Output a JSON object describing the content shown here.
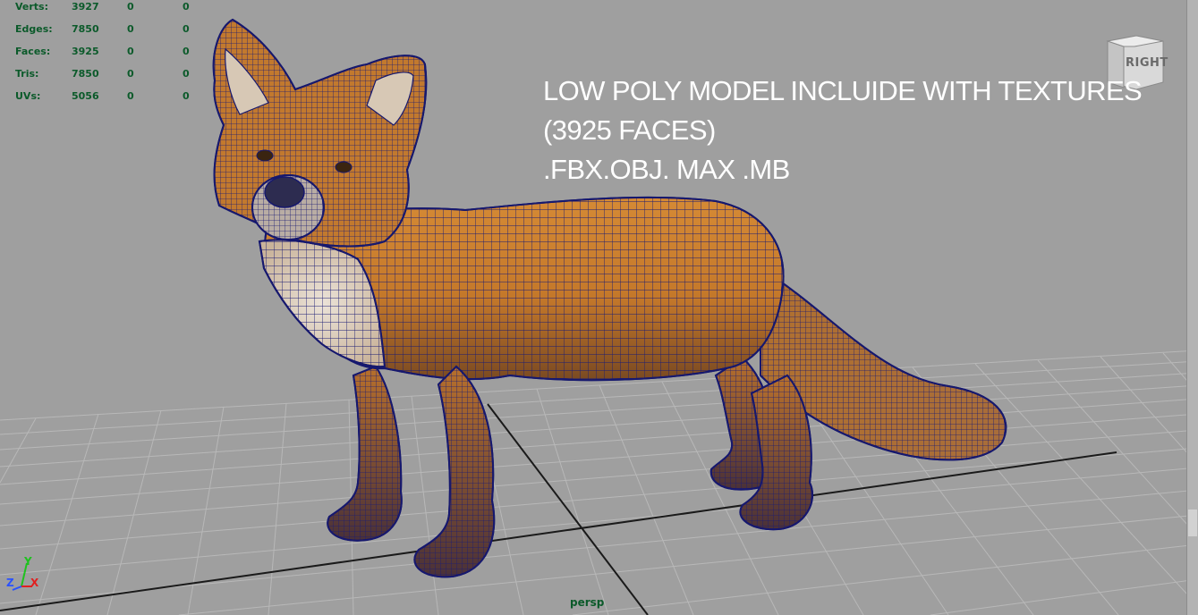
{
  "hud": {
    "rows": [
      {
        "label": "Verts:",
        "v1": "3927",
        "v2": "0",
        "v3": "0"
      },
      {
        "label": "Edges:",
        "v1": "7850",
        "v2": "0",
        "v3": "0"
      },
      {
        "label": "Faces:",
        "v1": "3925",
        "v2": "0",
        "v3": "0"
      },
      {
        "label": "Tris:",
        "v1": "7850",
        "v2": "0",
        "v3": "0"
      },
      {
        "label": "UVs:",
        "v1": "5056",
        "v2": "0",
        "v3": "0"
      }
    ]
  },
  "overlay": {
    "line1": "LOW POLY MODEL INCLUIDE WITH TEXTURES",
    "line2": "(3925 FACES)",
    "line3": ".FBX.OBJ. MAX .MB"
  },
  "viewcube": {
    "label": "RIGHT"
  },
  "camera": {
    "label": "persp"
  },
  "axis": {
    "x": "X",
    "y": "Y",
    "z": "Z"
  },
  "colors": {
    "viewport_bg": "#9f9f9f",
    "grid": "#b9b9b9",
    "grid_axis": "#1a1a1a",
    "hud_text": "#0b5a2a",
    "wire": "#16186e",
    "fur": "#c77a2a",
    "fur_light": "#e0d9cf"
  },
  "icons": [
    "view-cube-icon",
    "axis-gizmo-icon",
    "fox-model-icon"
  ]
}
